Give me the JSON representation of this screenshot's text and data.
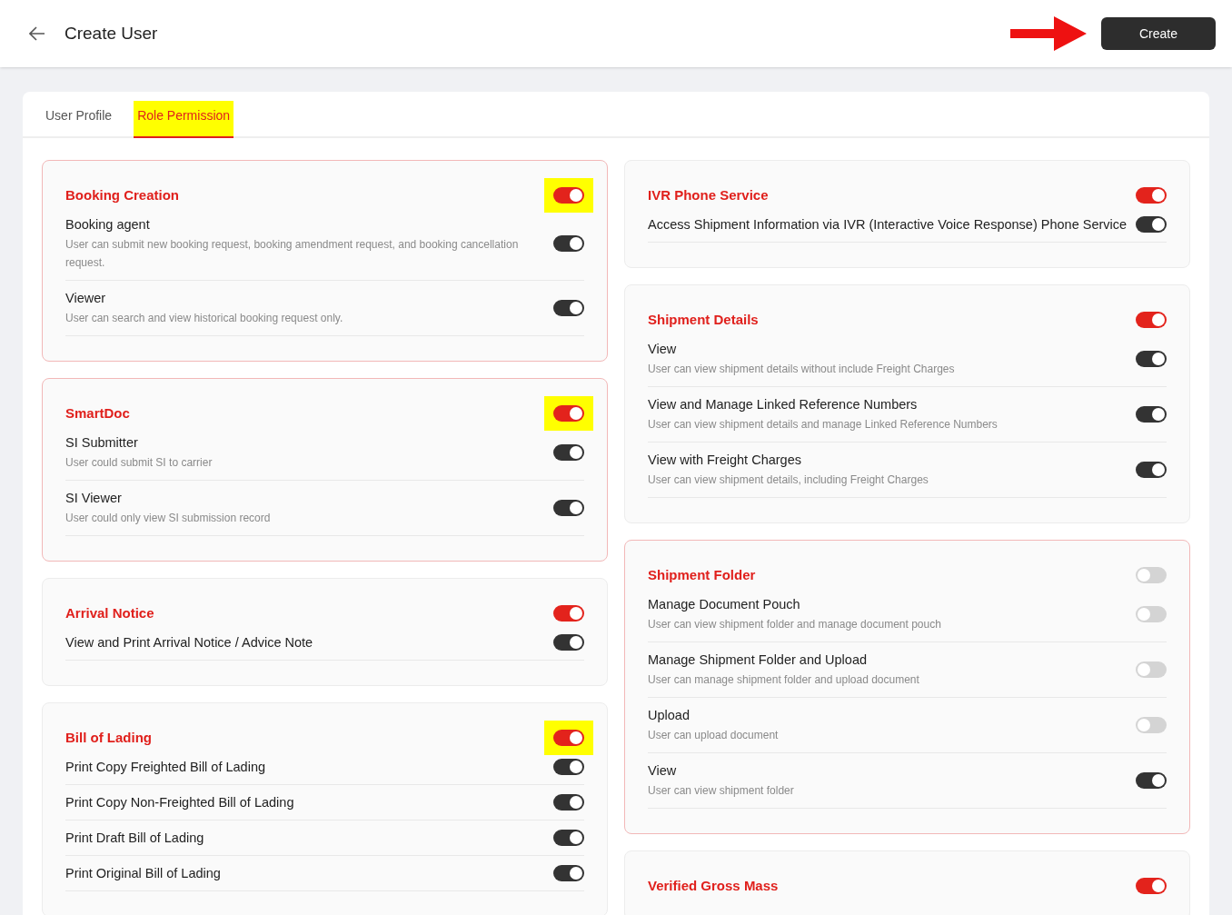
{
  "header": {
    "title": "Create User",
    "create_button": "Create",
    "arrow_annotation": true
  },
  "tabs": [
    {
      "label": "User Profile",
      "selected": false,
      "highlighted": false
    },
    {
      "label": "Role Permission",
      "selected": true,
      "highlighted": true
    }
  ],
  "columns": [
    {
      "sections": [
        {
          "title": "Booking Creation",
          "on": true,
          "highlighted": true,
          "selected": true,
          "items": [
            {
              "label": "Booking agent",
              "description": "User can submit new booking request, booking amendment request, and booking cancellation request.",
              "on": true
            },
            {
              "label": "Viewer",
              "description": "User can search and view historical booking request only.",
              "on": true
            }
          ]
        },
        {
          "title": "SmartDoc",
          "on": true,
          "highlighted": true,
          "selected": true,
          "items": [
            {
              "label": "SI Submitter",
              "description": "User could submit SI to carrier",
              "on": true
            },
            {
              "label": "SI Viewer",
              "description": "User could only view SI submission record",
              "on": true
            }
          ]
        },
        {
          "title": "Arrival Notice",
          "on": true,
          "highlighted": false,
          "selected": false,
          "items": [
            {
              "label": "View and Print Arrival Notice / Advice Note",
              "on": true
            }
          ]
        },
        {
          "title": "Bill of Lading",
          "on": true,
          "highlighted": true,
          "selected": false,
          "items": [
            {
              "label": "Print Copy Freighted Bill of Lading",
              "on": true
            },
            {
              "label": "Print Copy Non-Freighted Bill of Lading",
              "on": true
            },
            {
              "label": "Print Draft Bill of Lading",
              "on": true
            },
            {
              "label": "Print Original Bill of Lading",
              "on": true
            }
          ]
        }
      ]
    },
    {
      "sections": [
        {
          "title": "IVR Phone Service",
          "on": true,
          "highlighted": false,
          "selected": false,
          "items": [
            {
              "label": "Access Shipment Information via IVR (Interactive Voice Response) Phone Service",
              "on": true
            }
          ]
        },
        {
          "title": "Shipment Details",
          "on": true,
          "highlighted": false,
          "selected": false,
          "items": [
            {
              "label": "View",
              "description": "User can view shipment details without include Freight Charges",
              "on": true
            },
            {
              "label": "View and Manage Linked Reference Numbers",
              "description": "User can view shipment details and manage Linked Reference Numbers",
              "on": true
            },
            {
              "label": "View with Freight Charges",
              "description": "User can view shipment details, including Freight Charges",
              "on": true
            }
          ]
        },
        {
          "title": "Shipment Folder",
          "on": false,
          "highlighted": false,
          "selected": true,
          "items": [
            {
              "label": "Manage Document Pouch",
              "description": "User can view shipment folder and manage document pouch",
              "on": false
            },
            {
              "label": "Manage Shipment Folder and Upload",
              "description": "User can manage shipment folder and upload document",
              "on": false
            },
            {
              "label": "Upload",
              "description": "User can upload document",
              "on": false
            },
            {
              "label": "View",
              "description": "User can view shipment folder",
              "on": true
            }
          ]
        },
        {
          "title": "Verified Gross Mass",
          "on": true,
          "highlighted": false,
          "selected": false
        }
      ]
    }
  ]
}
